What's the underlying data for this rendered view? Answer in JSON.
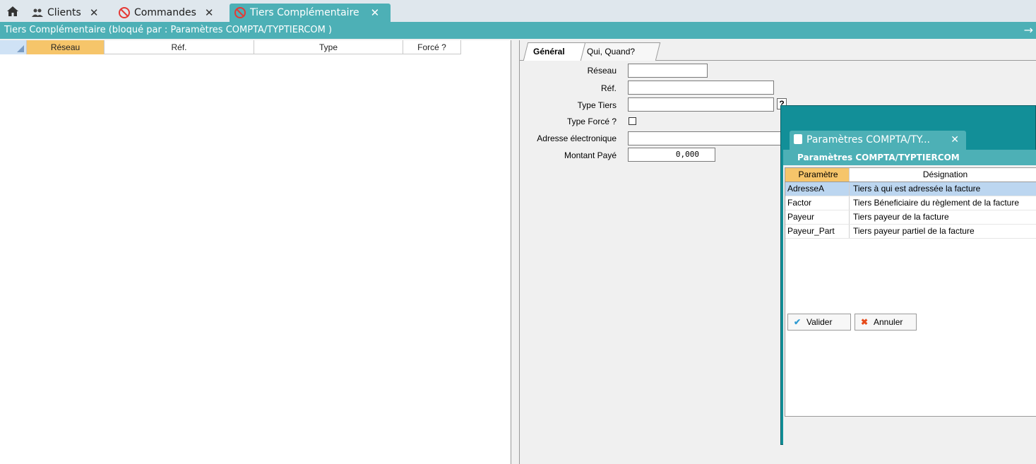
{
  "tabs": [
    {
      "label": "Clients",
      "icon": "users-icon"
    },
    {
      "label": "Commandes",
      "icon": "blocked-icon"
    },
    {
      "label": "Tiers Complémentaire",
      "icon": "blocked-icon",
      "active": true
    }
  ],
  "window": {
    "title": "Tiers Complémentaire (bloqué par : Paramètres COMPTA/TYPTIERCOM )"
  },
  "grid": {
    "columns": [
      "Réseau",
      "Réf.",
      "Type",
      "Forcé ?"
    ]
  },
  "form": {
    "tabs": [
      "Général",
      "Qui, Quand?"
    ],
    "fields": {
      "reseau_label": "Réseau",
      "ref_label": "Réf.",
      "type_tiers_label": "Type Tiers",
      "type_force_label": "Type Forcé ?",
      "adresse_label": "Adresse électronique",
      "montant_label": "Montant Payé",
      "montant_value": "0,000",
      "help_button": "?"
    }
  },
  "popup": {
    "tab_title": "Paramètres  COMPTA/TY...",
    "subtitle": "Paramètres COMPTA/TYPTIERCOM",
    "columns": [
      "Paramètre",
      "Désignation"
    ],
    "rows": [
      {
        "param": "AdresseA",
        "designation": "Tiers à qui est adressée la facture"
      },
      {
        "param": "Factor",
        "designation": "Tiers Béneficiaire du règlement de la facture"
      },
      {
        "param": "Payeur",
        "designation": "Tiers payeur de la facture"
      },
      {
        "param": "Payeur_Part",
        "designation": "Tiers payeur partiel de la facture"
      }
    ],
    "selected_row": "AdresseA",
    "buttons": {
      "ok": "Valider",
      "cancel": "Annuler"
    }
  },
  "colors": {
    "accent": "#4db0b6",
    "popup_bg": "#128f98",
    "header_highlight": "#f6c56a",
    "selection": "#bcd6f0"
  }
}
